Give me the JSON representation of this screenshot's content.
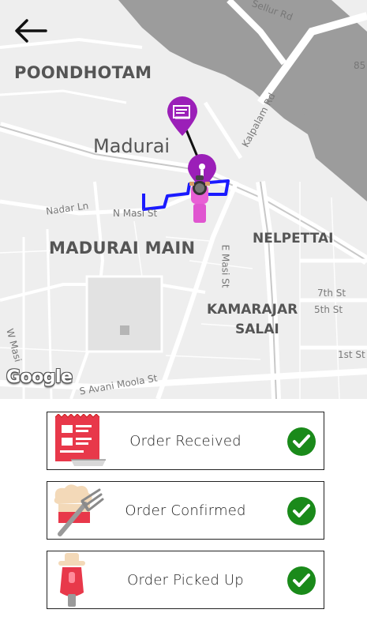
{
  "map": {
    "areas": {
      "poondhotam": "POONDHOTAM",
      "madurai_main": "MADURAI MAIN",
      "nelpettai": "NELPETTAI",
      "kamarajar_line1": "KAMARAJAR",
      "kamarajar_line2": "SALAI"
    },
    "city": "Madurai",
    "streets": {
      "sellur_rd": "Sellur Rd",
      "kalpalam_rd": "Kalpalam Rd",
      "nadar_ln": "Nadar Ln",
      "n_masi_st": "N Masi St",
      "e_masi_st": "E Masi St",
      "w_masi": "W Masi",
      "s_avani_moola_st": "S Avani Moola St",
      "seventh_st": "7th St",
      "fifth_st": "5th St",
      "first_st": "1st St",
      "road_number": "85"
    },
    "attribution": "Google",
    "route_color": "#1a1aff",
    "marker_color": "#9b1fb8"
  },
  "status_steps": [
    {
      "label": "Order Received",
      "icon": "restaurant-menu-icon",
      "done": true
    },
    {
      "label": "Order Confirmed",
      "icon": "chef-fork-icon",
      "done": true
    },
    {
      "label": "Order Picked Up",
      "icon": "scooter-icon",
      "done": true
    }
  ],
  "colors": {
    "check": "#1a8a1a",
    "accent_red": "#e8384a"
  }
}
